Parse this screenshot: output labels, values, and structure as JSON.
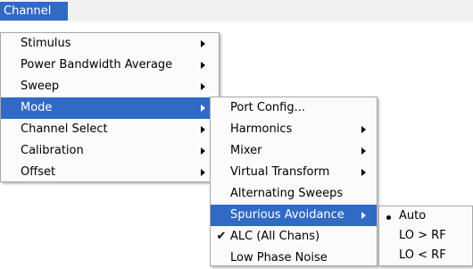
{
  "menubar": {
    "channel_label": "Channel"
  },
  "channel_menu": {
    "items": [
      {
        "label": "Stimulus"
      },
      {
        "label": "Power Bandwidth Average"
      },
      {
        "label": "Sweep"
      },
      {
        "label": "Mode"
      },
      {
        "label": "Channel Select"
      },
      {
        "label": "Calibration"
      },
      {
        "label": "Offset"
      }
    ]
  },
  "mode_menu": {
    "items": [
      {
        "label": "Port Config..."
      },
      {
        "label": "Harmonics"
      },
      {
        "label": "Mixer"
      },
      {
        "label": "Virtual Transform"
      },
      {
        "label": "Alternating Sweeps"
      },
      {
        "label": "Spurious Avoidance"
      },
      {
        "label": "ALC (All Chans)",
        "check": "✔"
      },
      {
        "label": "Low Phase Noise"
      }
    ]
  },
  "spurious_menu": {
    "items": [
      {
        "label": "Auto"
      },
      {
        "label": "LO > RF"
      },
      {
        "label": "LO < RF"
      }
    ]
  },
  "colors": {
    "highlight": "#316ac5",
    "menu_bg": "#fbfbfb",
    "menubar_bg": "#f1f1f1"
  },
  "icons": {
    "submenu": "chevron-right-icon",
    "checked": "checkmark-icon",
    "selected": "radio-dot-icon"
  }
}
